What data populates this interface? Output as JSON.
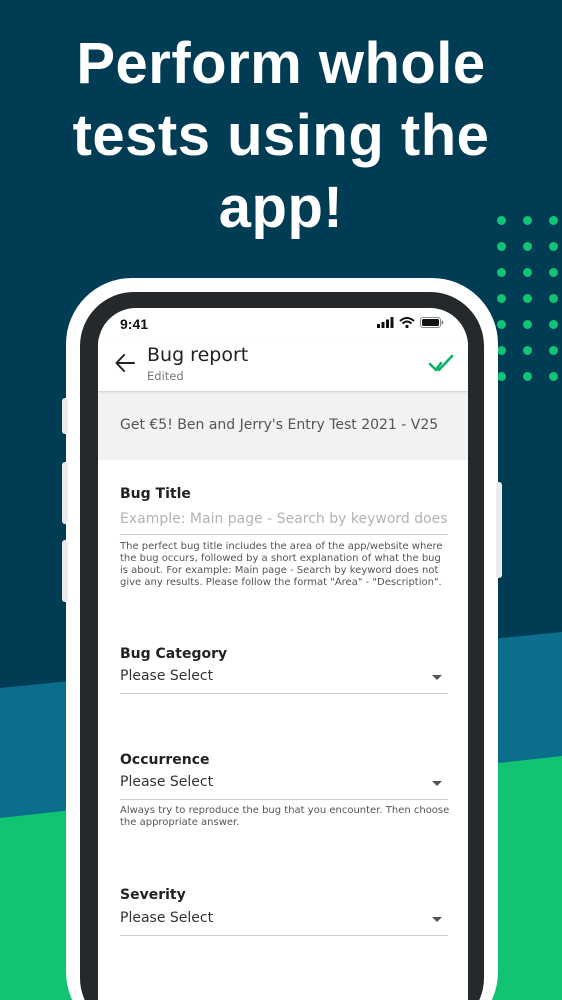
{
  "headline": [
    "Perform whole",
    "tests using the",
    "app!"
  ],
  "colors": {
    "background_dark": "#003d55",
    "accent_green": "#10c474",
    "band_blue": "#0a6e8c"
  },
  "status_bar": {
    "time": "9:41"
  },
  "app_bar": {
    "title": "Bug report",
    "subtitle": "Edited"
  },
  "test_title": "Get €5! Ben and Jerry's Entry Test 2021 - V25",
  "form": {
    "bug_title": {
      "label": "Bug Title",
      "placeholder": "Example: Main page - Search by keyword does not give any results",
      "help": "The perfect bug title includes the area of the app/website where the bug occurs, followed by a short explanation of what the bug is about. For example: Main page - Search by keyword does not give any results. Please follow the format \"Area\" - \"Description\"."
    },
    "bug_category": {
      "label": "Bug Category",
      "value": "Please Select"
    },
    "occurrence": {
      "label": "Occurrence",
      "value": "Please Select",
      "help": "Always try to reproduce the bug that you encounter. Then choose the appropriate answer."
    },
    "severity": {
      "label": "Severity",
      "value": "Please Select"
    }
  }
}
